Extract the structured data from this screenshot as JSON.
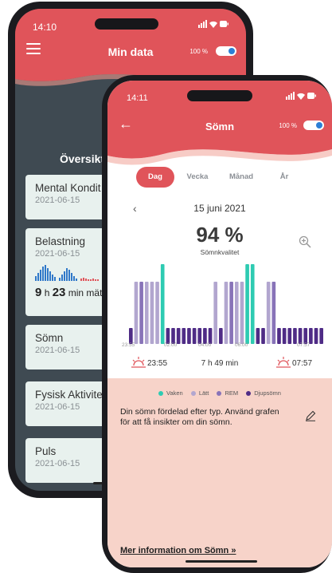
{
  "back_phone": {
    "status_time": "14:10",
    "title": "Min data",
    "battery_percent": "100 %",
    "overview_heading": "Översikt a",
    "cards": [
      {
        "title": "Mental Kondit",
        "date": "2021-06-15"
      },
      {
        "title": "Belastning",
        "date": "2021-06-15",
        "value_h": "9",
        "unit_h": "h",
        "value_m": "23",
        "unit_m": "min mätt"
      },
      {
        "title": "Sömn",
        "date": "2021-06-15"
      },
      {
        "title": "Fysisk Aktivite",
        "date": "2021-06-15"
      },
      {
        "title": "Puls",
        "date": "2021-06-15"
      }
    ]
  },
  "front_phone": {
    "status_time": "14:11",
    "title": "Sömn",
    "battery_percent": "100 %",
    "tabs": [
      "Dag",
      "Vecka",
      "Månad",
      "År"
    ],
    "active_tab": "Dag",
    "date": "15 juni 2021",
    "score": "94 %",
    "score_label": "Sömnkvalitet",
    "time_ticks": [
      "23:55",
      "02:00",
      "04:00",
      "06:00",
      "07:57"
    ],
    "bedtime": "23:55",
    "duration": "7 h 49 min",
    "wake_time": "07:57",
    "legend": [
      {
        "label": "Vaken",
        "color": "#2ecbb2"
      },
      {
        "label": "Lätt",
        "color": "#b2a6cf"
      },
      {
        "label": "REM",
        "color": "#8873b8"
      },
      {
        "label": "Djupsömn",
        "color": "#4f2c86"
      }
    ],
    "description": "Din sömn fördelad efter typ. Använd grafen för att få insikter om din sömn.",
    "more_link": "Mer information om Sömn »"
  },
  "chart_data": {
    "type": "bar",
    "categories": [
      "Djupsömn",
      "Lätt",
      "REM",
      "Vaken"
    ],
    "stage_levels": {
      "Djupsömn": 1,
      "REM": 2,
      "Lätt": 3,
      "Vaken": 4
    },
    "sequence": [
      1,
      3,
      2,
      3,
      3,
      3,
      4,
      1,
      1,
      1,
      1,
      1,
      1,
      1,
      1,
      1,
      3,
      1,
      3,
      2,
      3,
      3,
      4,
      4,
      1,
      1,
      3,
      2,
      1,
      1,
      1,
      1,
      1,
      1,
      1,
      1,
      1
    ],
    "xlabels": [
      "23:55",
      "02:00",
      "04:00",
      "06:00",
      "07:57"
    ],
    "colors": {
      "Vaken": "#2ecbb2",
      "Lätt": "#b2a6cf",
      "REM": "#8873b8",
      "Djupsömn": "#4f2c86"
    }
  }
}
